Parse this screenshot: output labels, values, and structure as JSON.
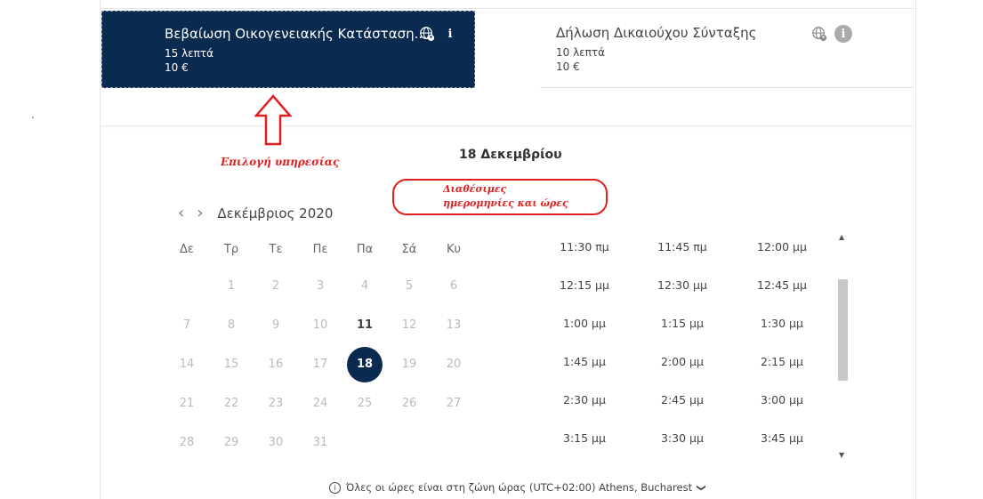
{
  "dot": ".",
  "services": [
    {
      "title": "Βεβαίωση Οικογενειακής Κατάσταση...",
      "duration": "15 λεπτά",
      "price": "10 €",
      "selected": true
    },
    {
      "title": "Δήλωση Δικαιούχου Σύνταξης",
      "duration": "10 λεπτά",
      "price": "10 €",
      "selected": false
    }
  ],
  "annotations": {
    "service_select": "Επιλογή υπηρεσίας",
    "available_line1": "Διαθέσιμες",
    "available_line2": "ημερομηνίες και ώρες"
  },
  "selected_date_title": "18 Δεκεμβρίου",
  "calendar": {
    "prev": "‹",
    "next": "›",
    "month_label": "Δεκέμβριος 2020",
    "weekdays": [
      "Δε",
      "Τρ",
      "Τε",
      "Πε",
      "Πα",
      "Σά",
      "Κυ"
    ],
    "weeks": [
      [
        "",
        "1",
        "2",
        "3",
        "4",
        "5",
        "6"
      ],
      [
        "7",
        "8",
        "9",
        "10",
        "11",
        "12",
        "13"
      ],
      [
        "14",
        "15",
        "16",
        "17",
        "18",
        "19",
        "20"
      ],
      [
        "21",
        "22",
        "23",
        "24",
        "25",
        "26",
        "27"
      ],
      [
        "28",
        "29",
        "30",
        "31",
        "",
        "",
        ""
      ]
    ],
    "available_days": [
      "11",
      "18"
    ],
    "selected_day": "18"
  },
  "time_slots": [
    [
      "11:30 πμ",
      "11:45 πμ",
      "12:00 μμ"
    ],
    [
      "12:15 μμ",
      "12:30 μμ",
      "12:45 μμ"
    ],
    [
      "1:00 μμ",
      "1:15 μμ",
      "1:30 μμ"
    ],
    [
      "1:45 μμ",
      "2:00 μμ",
      "2:15 μμ"
    ],
    [
      "2:30 μμ",
      "2:45 μμ",
      "3:00 μμ"
    ],
    [
      "3:15 μμ",
      "3:30 μμ",
      "3:45 μμ"
    ]
  ],
  "timezone_text": "Όλες οι ώρες είναι στη ζώνη ώρας  (UTC+02:00) Athens, Bucharest",
  "icons": {
    "info_glyph": "i",
    "scroll_up": "▲",
    "scroll_down": "▼",
    "chevron": "❯"
  },
  "colors": {
    "primary": "#0b2a4f",
    "annotation": "#e02020"
  }
}
